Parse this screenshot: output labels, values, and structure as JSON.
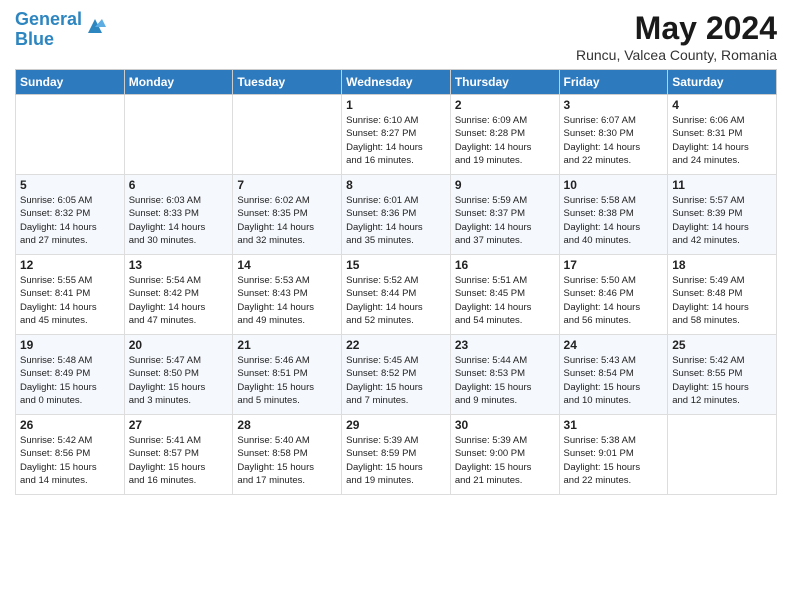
{
  "header": {
    "logo_line1": "General",
    "logo_line2": "Blue",
    "month": "May 2024",
    "location": "Runcu, Valcea County, Romania"
  },
  "days_of_week": [
    "Sunday",
    "Monday",
    "Tuesday",
    "Wednesday",
    "Thursday",
    "Friday",
    "Saturday"
  ],
  "weeks": [
    [
      {
        "day": "",
        "info": ""
      },
      {
        "day": "",
        "info": ""
      },
      {
        "day": "",
        "info": ""
      },
      {
        "day": "1",
        "info": "Sunrise: 6:10 AM\nSunset: 8:27 PM\nDaylight: 14 hours\nand 16 minutes."
      },
      {
        "day": "2",
        "info": "Sunrise: 6:09 AM\nSunset: 8:28 PM\nDaylight: 14 hours\nand 19 minutes."
      },
      {
        "day": "3",
        "info": "Sunrise: 6:07 AM\nSunset: 8:30 PM\nDaylight: 14 hours\nand 22 minutes."
      },
      {
        "day": "4",
        "info": "Sunrise: 6:06 AM\nSunset: 8:31 PM\nDaylight: 14 hours\nand 24 minutes."
      }
    ],
    [
      {
        "day": "5",
        "info": "Sunrise: 6:05 AM\nSunset: 8:32 PM\nDaylight: 14 hours\nand 27 minutes."
      },
      {
        "day": "6",
        "info": "Sunrise: 6:03 AM\nSunset: 8:33 PM\nDaylight: 14 hours\nand 30 minutes."
      },
      {
        "day": "7",
        "info": "Sunrise: 6:02 AM\nSunset: 8:35 PM\nDaylight: 14 hours\nand 32 minutes."
      },
      {
        "day": "8",
        "info": "Sunrise: 6:01 AM\nSunset: 8:36 PM\nDaylight: 14 hours\nand 35 minutes."
      },
      {
        "day": "9",
        "info": "Sunrise: 5:59 AM\nSunset: 8:37 PM\nDaylight: 14 hours\nand 37 minutes."
      },
      {
        "day": "10",
        "info": "Sunrise: 5:58 AM\nSunset: 8:38 PM\nDaylight: 14 hours\nand 40 minutes."
      },
      {
        "day": "11",
        "info": "Sunrise: 5:57 AM\nSunset: 8:39 PM\nDaylight: 14 hours\nand 42 minutes."
      }
    ],
    [
      {
        "day": "12",
        "info": "Sunrise: 5:55 AM\nSunset: 8:41 PM\nDaylight: 14 hours\nand 45 minutes."
      },
      {
        "day": "13",
        "info": "Sunrise: 5:54 AM\nSunset: 8:42 PM\nDaylight: 14 hours\nand 47 minutes."
      },
      {
        "day": "14",
        "info": "Sunrise: 5:53 AM\nSunset: 8:43 PM\nDaylight: 14 hours\nand 49 minutes."
      },
      {
        "day": "15",
        "info": "Sunrise: 5:52 AM\nSunset: 8:44 PM\nDaylight: 14 hours\nand 52 minutes."
      },
      {
        "day": "16",
        "info": "Sunrise: 5:51 AM\nSunset: 8:45 PM\nDaylight: 14 hours\nand 54 minutes."
      },
      {
        "day": "17",
        "info": "Sunrise: 5:50 AM\nSunset: 8:46 PM\nDaylight: 14 hours\nand 56 minutes."
      },
      {
        "day": "18",
        "info": "Sunrise: 5:49 AM\nSunset: 8:48 PM\nDaylight: 14 hours\nand 58 minutes."
      }
    ],
    [
      {
        "day": "19",
        "info": "Sunrise: 5:48 AM\nSunset: 8:49 PM\nDaylight: 15 hours\nand 0 minutes."
      },
      {
        "day": "20",
        "info": "Sunrise: 5:47 AM\nSunset: 8:50 PM\nDaylight: 15 hours\nand 3 minutes."
      },
      {
        "day": "21",
        "info": "Sunrise: 5:46 AM\nSunset: 8:51 PM\nDaylight: 15 hours\nand 5 minutes."
      },
      {
        "day": "22",
        "info": "Sunrise: 5:45 AM\nSunset: 8:52 PM\nDaylight: 15 hours\nand 7 minutes."
      },
      {
        "day": "23",
        "info": "Sunrise: 5:44 AM\nSunset: 8:53 PM\nDaylight: 15 hours\nand 9 minutes."
      },
      {
        "day": "24",
        "info": "Sunrise: 5:43 AM\nSunset: 8:54 PM\nDaylight: 15 hours\nand 10 minutes."
      },
      {
        "day": "25",
        "info": "Sunrise: 5:42 AM\nSunset: 8:55 PM\nDaylight: 15 hours\nand 12 minutes."
      }
    ],
    [
      {
        "day": "26",
        "info": "Sunrise: 5:42 AM\nSunset: 8:56 PM\nDaylight: 15 hours\nand 14 minutes."
      },
      {
        "day": "27",
        "info": "Sunrise: 5:41 AM\nSunset: 8:57 PM\nDaylight: 15 hours\nand 16 minutes."
      },
      {
        "day": "28",
        "info": "Sunrise: 5:40 AM\nSunset: 8:58 PM\nDaylight: 15 hours\nand 17 minutes."
      },
      {
        "day": "29",
        "info": "Sunrise: 5:39 AM\nSunset: 8:59 PM\nDaylight: 15 hours\nand 19 minutes."
      },
      {
        "day": "30",
        "info": "Sunrise: 5:39 AM\nSunset: 9:00 PM\nDaylight: 15 hours\nand 21 minutes."
      },
      {
        "day": "31",
        "info": "Sunrise: 5:38 AM\nSunset: 9:01 PM\nDaylight: 15 hours\nand 22 minutes."
      },
      {
        "day": "",
        "info": ""
      }
    ]
  ]
}
